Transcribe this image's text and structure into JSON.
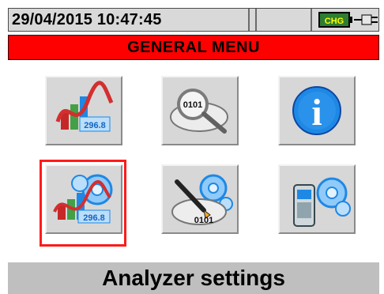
{
  "status": {
    "datetime": "29/04/2015 10:47:45",
    "middle_field": "",
    "battery_icon_text": "CHG",
    "plug_icon": "power-plug-icon"
  },
  "header": {
    "title": "GENERAL MENU"
  },
  "tiles": [
    {
      "name": "tile-measurements",
      "icon": "chart-icon",
      "text": "296.8"
    },
    {
      "name": "tile-recall",
      "icon": "magnifier-disk-icon",
      "text": "0101"
    },
    {
      "name": "tile-info",
      "icon": "info-icon",
      "text": "i"
    },
    {
      "name": "tile-analyzer-settings",
      "icon": "settings-chart-icon",
      "text": "296.8"
    },
    {
      "name": "tile-save-settings",
      "icon": "pen-disk-icon",
      "text": "0101"
    },
    {
      "name": "tile-device-settings",
      "icon": "device-settings-icon",
      "text": ""
    }
  ],
  "footer": {
    "label": "Analyzer settings"
  },
  "colors": {
    "header_bg": "#ff0000",
    "selection": "#ff1a1a",
    "tile_bg": "#d7d7d7"
  }
}
